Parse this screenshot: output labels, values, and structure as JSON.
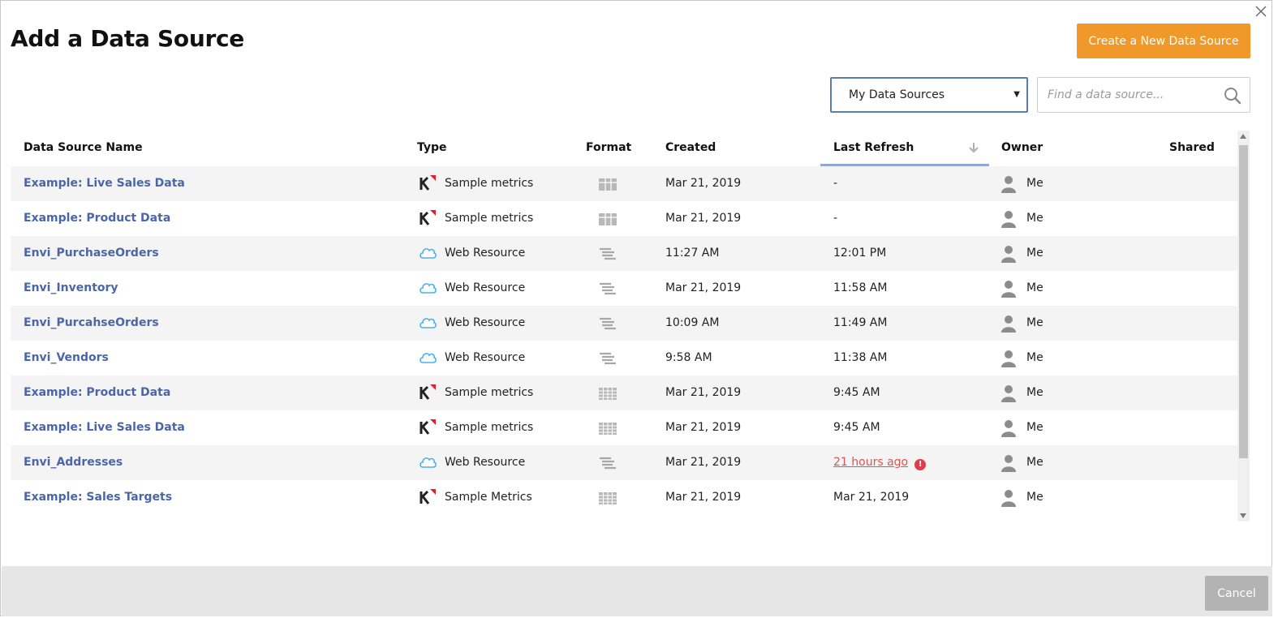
{
  "dialog": {
    "title": "Add a Data Source",
    "create_button": "Create a New Data Source",
    "filter": {
      "selected": "My Data Sources"
    },
    "search": {
      "placeholder": "Find a data source..."
    },
    "cancel_button": "Cancel"
  },
  "table": {
    "columns": {
      "name": "Data Source Name",
      "type": "Type",
      "format": "Format",
      "created": "Created",
      "last_refresh": "Last Refresh",
      "owner": "Owner",
      "shared": "Shared"
    },
    "sort": {
      "column": "Last Refresh",
      "direction": "descending"
    },
    "rows": [
      {
        "name": "Example: Live Sales Data",
        "type_icon": "klipfolio-icon",
        "type": "Sample metrics",
        "format_icon": "table-icon",
        "created": "Mar 21, 2019",
        "last_refresh": "-",
        "owner": "Me"
      },
      {
        "name": "Example: Product Data",
        "type_icon": "klipfolio-icon",
        "type": "Sample metrics",
        "format_icon": "table-icon",
        "created": "Mar 21, 2019",
        "last_refresh": "-",
        "owner": "Me"
      },
      {
        "name": "Envi_PurchaseOrders",
        "type_icon": "cloud-icon",
        "type": "Web Resource",
        "format_icon": "tree-icon",
        "created": "11:27 AM",
        "last_refresh": "12:01 PM",
        "owner": "Me"
      },
      {
        "name": "Envi_Inventory",
        "type_icon": "cloud-icon",
        "type": "Web Resource",
        "format_icon": "tree-icon",
        "created": "Mar 21, 2019",
        "last_refresh": "11:58 AM",
        "owner": "Me"
      },
      {
        "name": "Envi_PurcahseOrders",
        "type_icon": "cloud-icon",
        "type": "Web Resource",
        "format_icon": "tree-icon",
        "created": "10:09 AM",
        "last_refresh": "11:49 AM",
        "owner": "Me"
      },
      {
        "name": "Envi_Vendors",
        "type_icon": "cloud-icon",
        "type": "Web Resource",
        "format_icon": "tree-icon",
        "created": "9:58 AM",
        "last_refresh": "11:38 AM",
        "owner": "Me"
      },
      {
        "name": "Example: Product Data",
        "type_icon": "klipfolio-icon",
        "type": "Sample metrics",
        "format_icon": "grid-icon",
        "created": "Mar 21, 2019",
        "last_refresh": "9:45 AM",
        "owner": "Me"
      },
      {
        "name": "Example: Live Sales Data",
        "type_icon": "klipfolio-icon",
        "type": "Sample metrics",
        "format_icon": "grid-icon",
        "created": "Mar 21, 2019",
        "last_refresh": "9:45 AM",
        "owner": "Me"
      },
      {
        "name": "Envi_Addresses",
        "type_icon": "cloud-icon",
        "type": "Web Resource",
        "format_icon": "tree-icon",
        "created": "Mar 21, 2019",
        "last_refresh": "21 hours ago",
        "refresh_warning": true,
        "owner": "Me"
      },
      {
        "name": "Example: Sales Targets",
        "type_icon": "klipfolio-icon",
        "type": "Sample Metrics",
        "format_icon": "grid-icon",
        "created": "Mar 21, 2019",
        "last_refresh": "Mar 21, 2019",
        "owner": "Me"
      }
    ]
  },
  "colors": {
    "accent": "#f0982a",
    "link": "#4a66a8",
    "warning": "#e23c4b",
    "row_alt": "#f4f4f4",
    "sort_indicator": "#8fa8d8"
  }
}
